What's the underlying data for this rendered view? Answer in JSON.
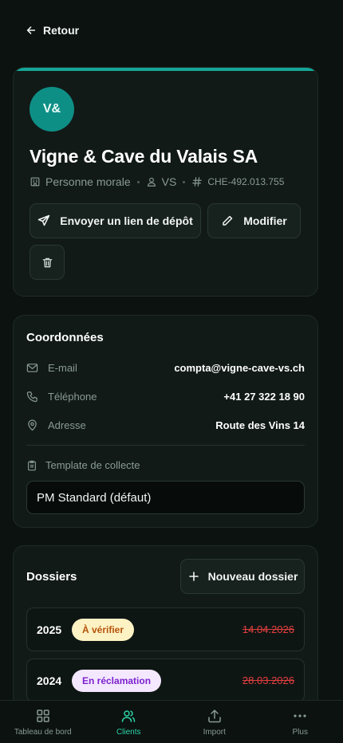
{
  "nav": {
    "back_label": "Retour"
  },
  "client": {
    "initials": "V&",
    "name": "Vigne & Cave du Valais SA",
    "type": "Personne morale",
    "canton": "VS",
    "uid": "CHE-492.013.755",
    "accent_color": "#14a697"
  },
  "actions": {
    "send_link": "Envoyer un lien de dépôt",
    "edit": "Modifier",
    "delete_icon": "trash-icon"
  },
  "contact": {
    "title": "Coordonnées",
    "email_label": "E-mail",
    "email": "compta@vigne-cave-vs.ch",
    "phone_label": "Téléphone",
    "phone": "+41 27 322 18 90",
    "address_label": "Adresse",
    "address": "Route des Vins 14",
    "template_label": "Template de collecte",
    "template_value": "PM Standard (défaut)"
  },
  "dossiers": {
    "title": "Dossiers",
    "new_label": "Nouveau dossier",
    "items": [
      {
        "year": "2025",
        "status": "À vérifier",
        "date": "14.04.2026",
        "status_color": "#fdf2c4"
      },
      {
        "year": "2024",
        "status": "En réclamation",
        "date": "28.03.2026",
        "status_color": "#f3e8ff"
      }
    ]
  },
  "tabs": [
    {
      "label": "Tableau de bord",
      "icon": "dashboard-icon"
    },
    {
      "label": "Clients",
      "icon": "users-icon",
      "active": true
    },
    {
      "label": "Import",
      "icon": "upload-icon"
    },
    {
      "label": "Plus",
      "icon": "more-icon"
    }
  ]
}
